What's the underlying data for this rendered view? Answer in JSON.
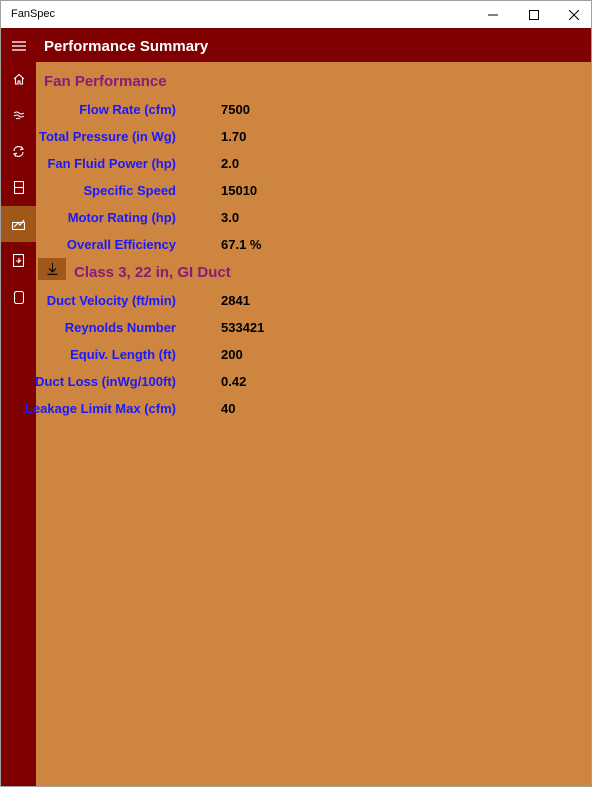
{
  "window": {
    "title": "FanSpec"
  },
  "header": {
    "title": "Performance Summary"
  },
  "sidebar": {
    "items": [
      {
        "icon": "menu-icon"
      },
      {
        "icon": "home-icon"
      },
      {
        "icon": "fan-icon"
      },
      {
        "icon": "refresh-icon"
      },
      {
        "icon": "duct-icon"
      },
      {
        "icon": "performance-icon",
        "active": true
      },
      {
        "icon": "report-icon"
      },
      {
        "icon": "tablet-icon"
      }
    ]
  },
  "fan_performance": {
    "title": "Fan Performance",
    "rows": [
      {
        "label": "Flow Rate (cfm)",
        "value": "7500"
      },
      {
        "label": "Total Pressure (in Wg)",
        "value": "1.70"
      },
      {
        "label": "Fan Fluid Power (hp)",
        "value": "2.0"
      },
      {
        "label": "Specific Speed",
        "value": "15010"
      },
      {
        "label": "Motor Rating (hp)",
        "value": "3.0"
      },
      {
        "label": "Overall Efficiency",
        "value": "67.1 %"
      }
    ]
  },
  "duct": {
    "title": "Class 3, 22 in, GI Duct",
    "rows": [
      {
        "label": "Duct Velocity (ft/min)",
        "value": "2841"
      },
      {
        "label": "Reynolds Number",
        "value": "533421"
      },
      {
        "label": "Equiv. Length (ft)",
        "value": "200"
      },
      {
        "label": "Duct Loss (inWg/100ft)",
        "value": "0.42"
      },
      {
        "label": "Leakage Limit Max (cfm)",
        "value": "40"
      }
    ]
  },
  "colors": {
    "chrome": "#7f0000",
    "active_nav": "#a0571a",
    "content_bg": "#cd853f",
    "section_title": "#8b1a7a",
    "label": "#1a1aff",
    "value": "#000000"
  }
}
